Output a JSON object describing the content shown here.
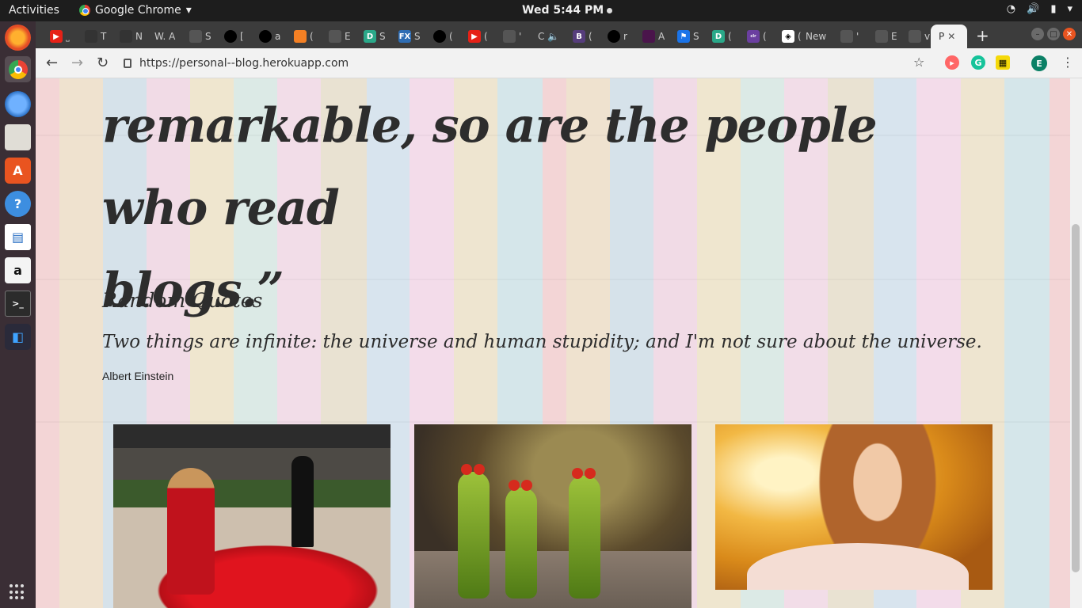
{
  "topbar": {
    "activities": "Activities",
    "app_name": "Google Chrome",
    "clock": "Wed  5:44 PM"
  },
  "dock": {
    "items": [
      "firefox",
      "chrome",
      "thunderbird",
      "files",
      "software-center",
      "help",
      "libreoffice-writer",
      "amazon",
      "terminal",
      "vscode"
    ]
  },
  "tabs": {
    "partial_labels": [
      "˽",
      "T",
      "N",
      "W. A",
      "S",
      "[",
      "a",
      "(",
      "E",
      "S",
      "S",
      "(",
      "(",
      "'",
      "C",
      "(",
      "r",
      "A",
      "S",
      "(",
      "(",
      "(",
      "New",
      "'",
      "E",
      "v"
    ],
    "active_label": "P"
  },
  "toolbar": {
    "url": "https://personal--blog.herokuapp.com",
    "profile_initial": "E"
  },
  "page": {
    "quote_lines": [
      "remarkable, so are the people who read",
      "blogs.”"
    ],
    "random_quotes_heading": "Random Quotes",
    "quote_text": "Two things are infinite: the universe and human stupidity; and I'm not sure about the universe.",
    "quote_author": "Albert Einstein"
  },
  "colors": {
    "dock_bg": "#3a2e35",
    "topbar_bg": "#1d1d1d",
    "tabstrip_bg": "#3c3c3c",
    "text_dark": "#2d2d2d",
    "ubuntu_orange": "#e95420"
  }
}
